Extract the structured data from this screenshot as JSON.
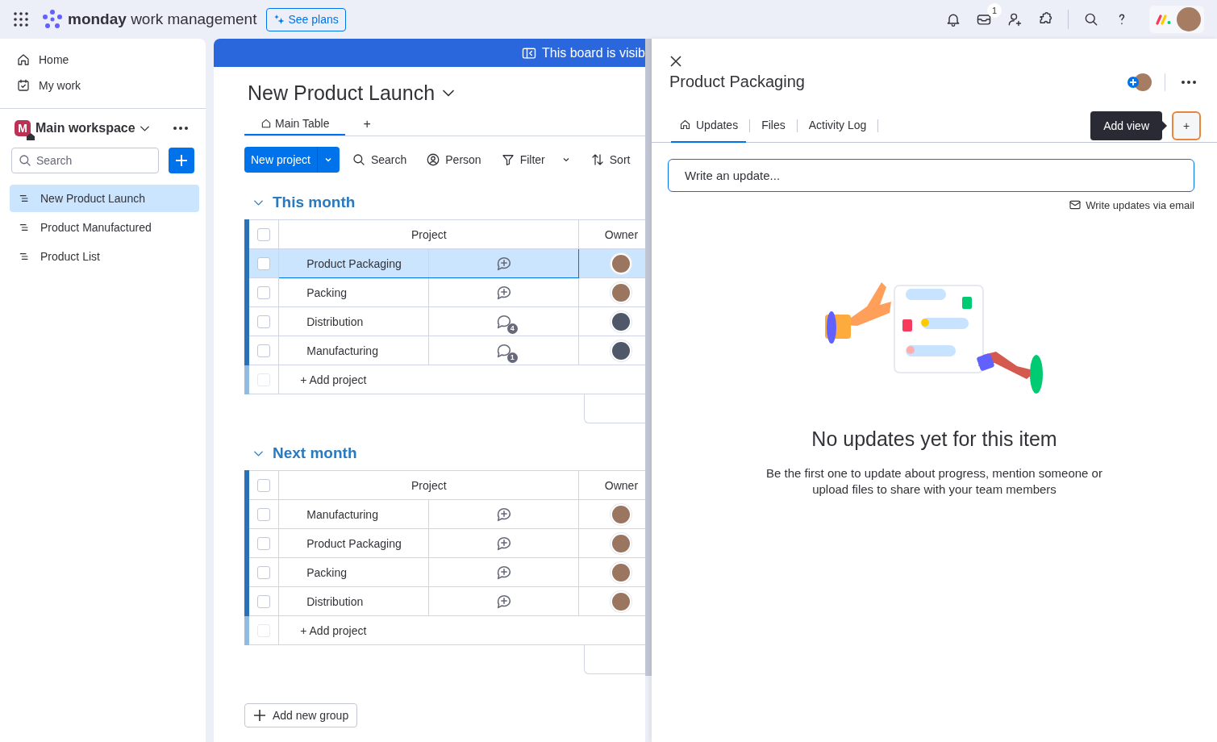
{
  "topbar": {
    "brand_bold": "monday",
    "brand_light": "work management",
    "plans_button": "See plans",
    "inbox_badge": "1"
  },
  "sidebar": {
    "nav": [
      {
        "label": "Home"
      },
      {
        "label": "My work"
      }
    ],
    "workspace": {
      "initial": "M",
      "name": "Main workspace"
    },
    "search": {
      "placeholder": "Search"
    },
    "boards": [
      {
        "label": "New Product Launch",
        "selected": true
      },
      {
        "label": "Product Manufactured",
        "selected": false
      },
      {
        "label": "Product List",
        "selected": false
      }
    ]
  },
  "board": {
    "banner": "This board is visib",
    "title": "New Product Launch",
    "views": [
      {
        "label": "Main Table",
        "selected": true
      }
    ],
    "add_view": "+",
    "new_button": "New project",
    "tools": [
      {
        "label": "Search"
      },
      {
        "label": "Person"
      },
      {
        "label": "Filter"
      },
      {
        "label": "Sort"
      }
    ],
    "groups": [
      {
        "title": "This month",
        "columns": [
          "Project",
          "Owner"
        ],
        "select_all": {
          "checked": false
        },
        "add_row": "+ Add project",
        "add_row_checkbox": {
          "checked": false,
          "disabled": true
        },
        "rows": [
          {
            "name": "Product Packaging",
            "selected": true,
            "checked": false,
            "owner": {
              "color": "#9a7560"
            }
          },
          {
            "name": "Packing",
            "selected": false,
            "checked": false,
            "owner": {
              "color": "#9a7560"
            }
          },
          {
            "name": "Distribution",
            "selected": false,
            "checked": false,
            "updates": "4",
            "owner": {
              "color": "#4e5868"
            }
          },
          {
            "name": "Manufacturing",
            "selected": false,
            "checked": false,
            "updates": "1",
            "owner": {
              "color": "#4e5868"
            }
          }
        ]
      },
      {
        "title": "Next month",
        "columns": [
          "Project",
          "Owner"
        ],
        "select_all": {
          "checked": false
        },
        "add_row": "+ Add project",
        "add_row_checkbox": {
          "checked": false,
          "disabled": true
        },
        "rows": [
          {
            "name": "Manufacturing",
            "selected": false,
            "checked": false,
            "owner": {
              "color": "#9a7560"
            }
          },
          {
            "name": "Product Packaging",
            "selected": false,
            "checked": false,
            "owner": {
              "color": "#9a7560"
            }
          },
          {
            "name": "Packing",
            "selected": false,
            "checked": false,
            "owner": {
              "color": "#9a7560"
            }
          },
          {
            "name": "Distribution",
            "selected": false,
            "checked": false,
            "owner": {
              "color": "#9a7560"
            }
          }
        ]
      }
    ],
    "add_group": "Add new group"
  },
  "panel": {
    "title": "Product Packaging",
    "tabs": [
      {
        "label": "Updates",
        "selected": true
      },
      {
        "label": "Files",
        "selected": false
      },
      {
        "label": "Activity Log",
        "selected": false
      }
    ],
    "tooltip": "Add view",
    "add_view": "+",
    "composer": {
      "placeholder": "Write an update..."
    },
    "email_link": "Write updates via email",
    "empty_title": "No updates yet for this item",
    "empty_text": "Be the first one to update about progress, mention someone or upload files to share with your team members"
  }
}
